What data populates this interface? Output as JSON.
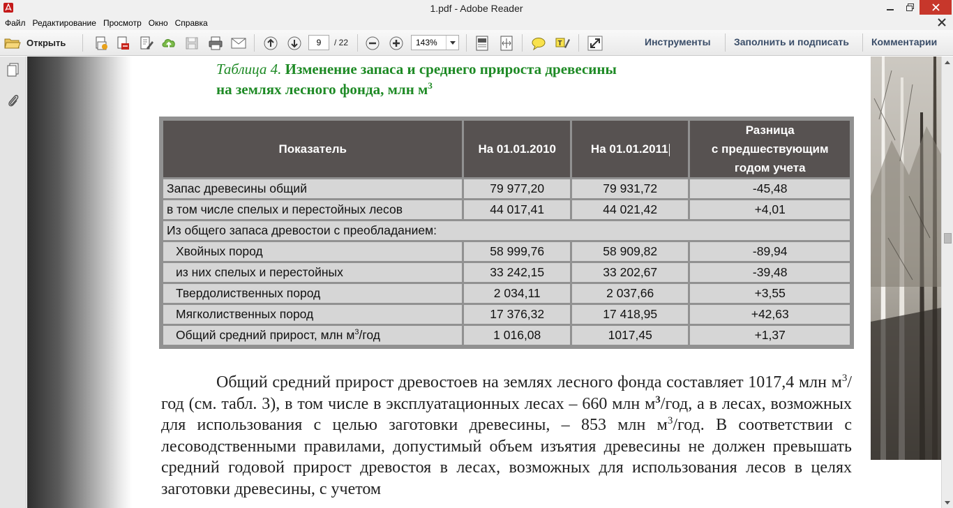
{
  "window": {
    "title": "1.pdf - Adobe Reader",
    "app_icon": "adobe-reader-icon"
  },
  "menu": {
    "items": [
      "Файл",
      "Редактирование",
      "Просмотр",
      "Окно",
      "Справка"
    ]
  },
  "toolbar": {
    "open_label": "Открыть",
    "page_current": "9",
    "page_total": "/ 22",
    "zoom": "143%",
    "tools_label": "Инструменты",
    "fill_sign_label": "Заполнить и подписать",
    "comments_label": "Комментарии"
  },
  "document": {
    "caption_prefix": "Таблица 4.",
    "caption_line1": "Изменение запаса и среднего прироста древесины",
    "caption_line2": "на землях лесного фонда, млн м",
    "caption_sup": "3",
    "table": {
      "headers": [
        "Показатель",
        "На 01.01.2010",
        "На 01.01.2011",
        "Разница",
        "с предшествующим",
        "годом учета"
      ],
      "rows": [
        {
          "label": "Запас древесины общий",
          "v2010": "79 977,20",
          "v2011": "79 931,72",
          "diff": "-45,48"
        },
        {
          "label": "в том числе спелых и перестойных лесов",
          "v2010": "44 017,41",
          "v2011": "44 021,42",
          "diff": "+4,01"
        },
        {
          "label": "Из общего запаса древостои с преобладанием:"
        },
        {
          "label": "Хвойных пород",
          "v2010": "58 999,76",
          "v2011": "58 909,82",
          "diff": "-89,94"
        },
        {
          "label": "из них спелых и перестойных",
          "v2010": "33 242,15",
          "v2011": "33 202,67",
          "diff": "-39,48"
        },
        {
          "label": "Твердолиственных пород",
          "v2010": "2 034,11",
          "v2011": "2 037,66",
          "diff": "+3,55"
        },
        {
          "label": "Мягколиственных пород",
          "v2010": "17 376,32",
          "v2011": "17 418,95",
          "diff": "+42,63"
        },
        {
          "label_pre": "Общий средний прирост, млн м",
          "label_sup": "3",
          "label_post": "/год",
          "v2010": "1 016,08",
          "v2011": "1017,45",
          "diff": "+1,37"
        }
      ]
    },
    "paragraph": {
      "p1": "Общий средний прирост древостоев на землях лесного фонда составляет 1017,4 млн м",
      "sup1": "3",
      "p2": "/год (см. табл. 3), в том числе в эксплуатационных лесах – 660 млн м",
      "sup2": "3",
      "p3": "/год, а в лесах, возможных для использования с целью заготовки древесины, – 853 млн м",
      "sup3": "3",
      "p4": "/год. В соответствии с лесоводственными правилами, допустимый объем изъятия древесины не должен превышать средний годовой прирост древостоя в лесах, возможных для использования лесов в целях заготовки древесины, с учетом"
    }
  }
}
